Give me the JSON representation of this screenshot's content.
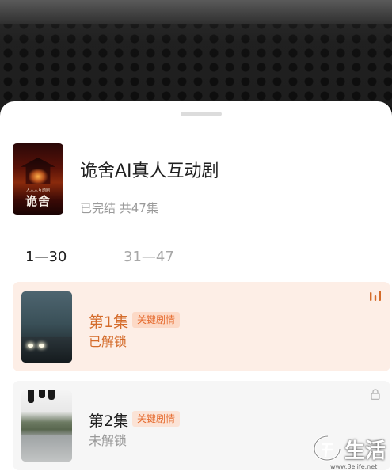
{
  "show": {
    "cover_small_text": "人人人互动剧",
    "cover_big_text": "诡舍",
    "title": "诡舍AI真人互动剧",
    "meta": "已完结 共47集"
  },
  "tabs": [
    {
      "label": "1—30",
      "active": true
    },
    {
      "label": "31—47",
      "active": false
    }
  ],
  "episodes": [
    {
      "title": "第1集",
      "tag": "关键剧情",
      "status": "已解锁",
      "icon": "playing-bars-icon"
    },
    {
      "title": "第2集",
      "tag": "关键剧情",
      "status": "未解锁",
      "icon": "lock-icon"
    }
  ],
  "watermark": {
    "text": "生活",
    "url": "www.3elife.net"
  },
  "colors": {
    "accent": "#d46b2a",
    "tag_text": "#e56b2f",
    "active_card_bg": "#fdeee6",
    "inactive_card_bg": "#f6f6f6"
  }
}
